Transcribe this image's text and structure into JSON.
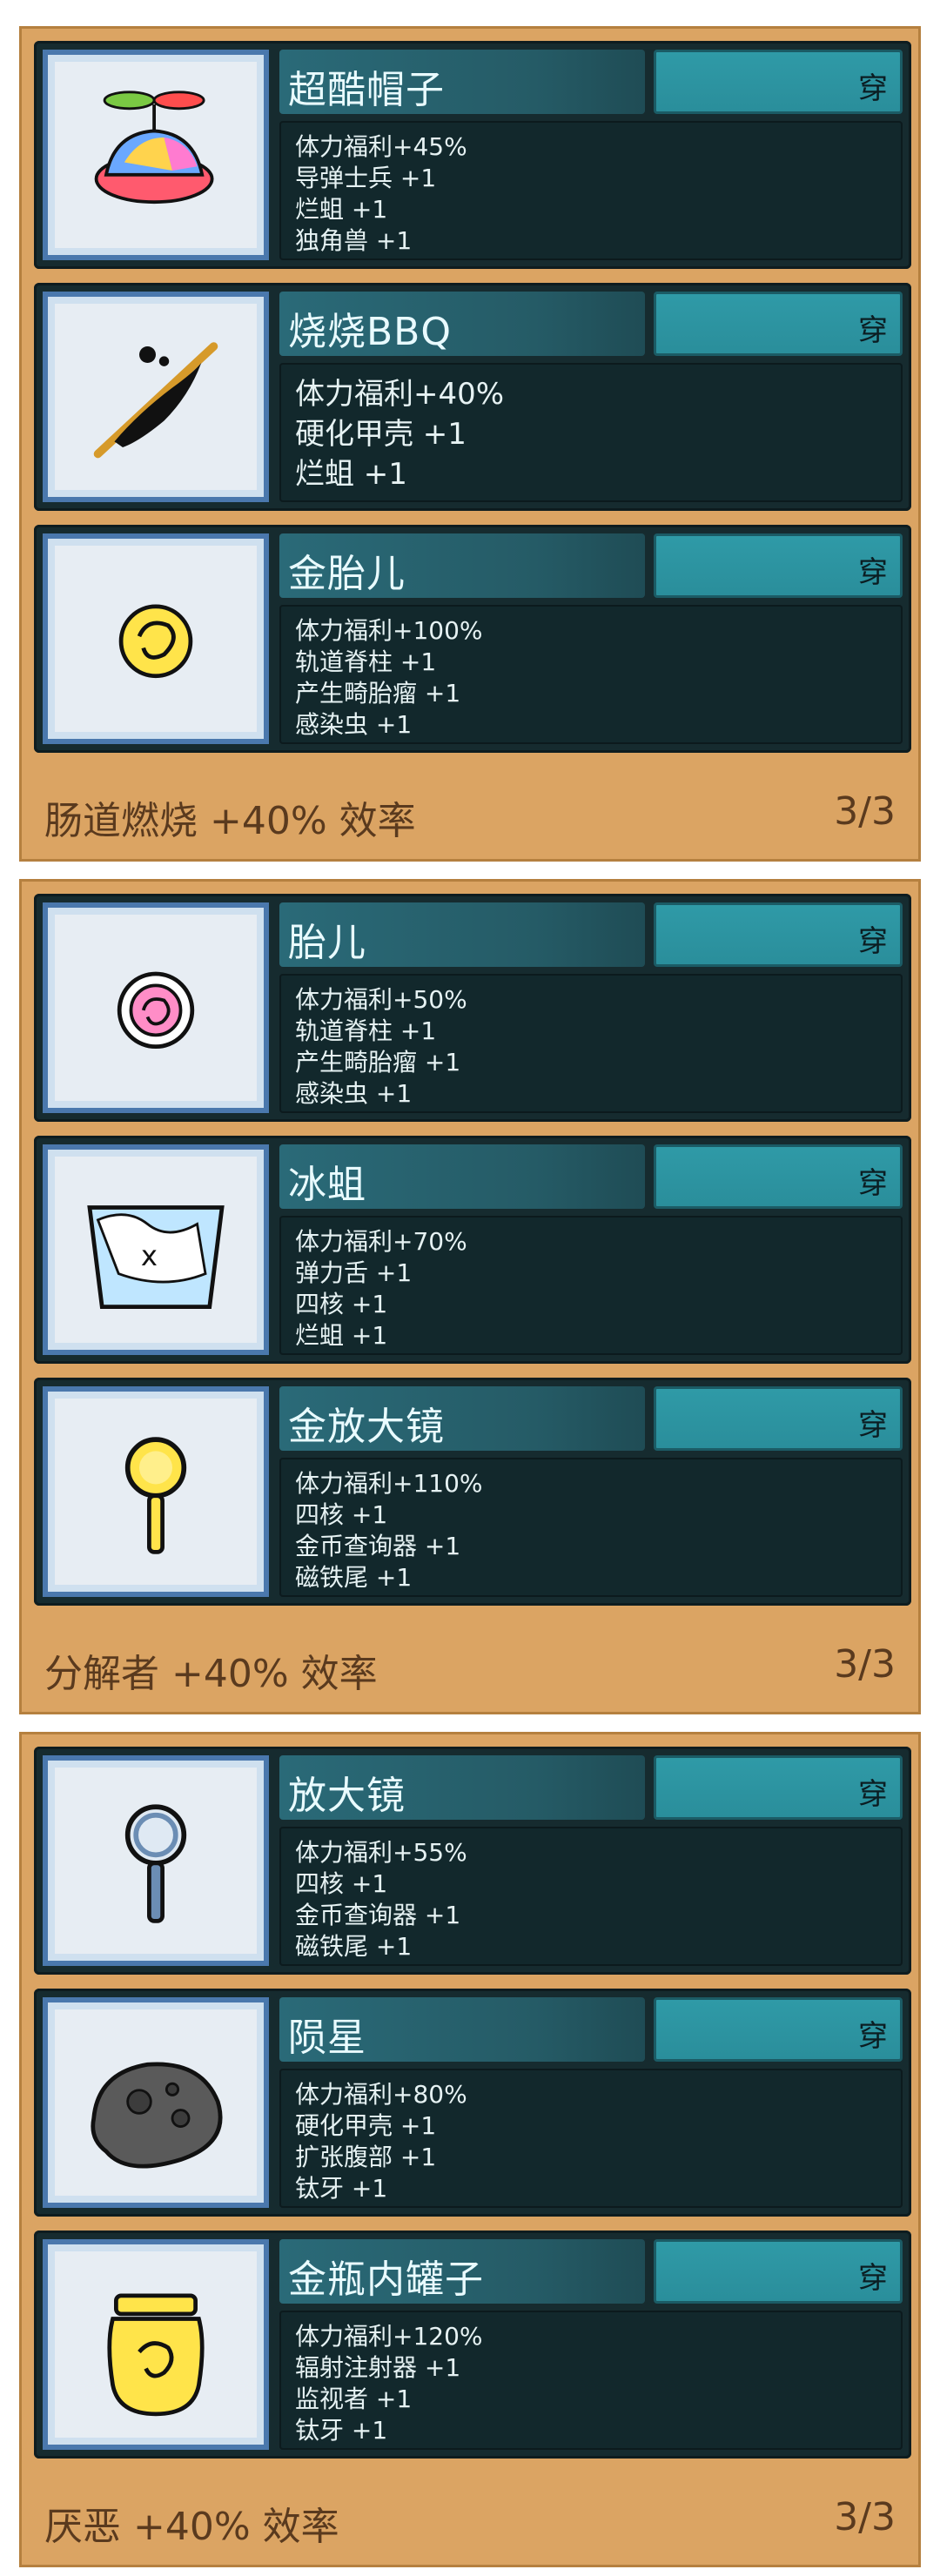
{
  "sets": [
    {
      "items": [
        {
          "name": "超酷帽子",
          "button": "穿",
          "stats": [
            "体力福利+45%",
            "导弹士兵 +1",
            "烂蛆 +1",
            "独角兽 +1"
          ],
          "icon": "propeller-hat-icon"
        },
        {
          "name": "烧烧BBQ",
          "button": "穿",
          "stats": [
            "体力福利+40%",
            "硬化甲壳 +1",
            "烂蛆 +1"
          ],
          "icon": "burnt-skewer-icon"
        },
        {
          "name": "金胎儿",
          "button": "穿",
          "stats": [
            "体力福利+100%",
            "轨道脊柱 +1",
            "产生畸胎瘤 +1",
            "感染虫 +1"
          ],
          "icon": "gold-fetus-icon"
        }
      ],
      "footer": {
        "bonus": "肠道燃烧 +40% 效率",
        "count": "3/3"
      }
    },
    {
      "items": [
        {
          "name": "胎儿",
          "button": "穿",
          "stats": [
            "体力福利+50%",
            "轨道脊柱 +1",
            "产生畸胎瘤 +1",
            "感染虫 +1"
          ],
          "icon": "fetus-icon"
        },
        {
          "name": "冰蛆",
          "button": "穿",
          "stats": [
            "体力福利+70%",
            "弹力舌 +1",
            "四核 +1",
            "烂蛆 +1"
          ],
          "icon": "ice-maggot-icon"
        },
        {
          "name": "金放大镜",
          "button": "穿",
          "stats": [
            "体力福利+110%",
            "四核 +1",
            "金币查询器 +1",
            "磁铁尾 +1"
          ],
          "icon": "gold-magnifier-icon"
        }
      ],
      "footer": {
        "bonus": "分解者 +40% 效率",
        "count": "3/3"
      }
    },
    {
      "items": [
        {
          "name": "放大镜",
          "button": "穿",
          "stats": [
            "体力福利+55%",
            "四核 +1",
            "金币查询器 +1",
            "磁铁尾 +1"
          ],
          "icon": "magnifier-icon"
        },
        {
          "name": "陨星",
          "button": "穿",
          "stats": [
            "体力福利+80%",
            "硬化甲壳 +1",
            "扩张腹部 +1",
            "钛牙 +1"
          ],
          "icon": "meteor-icon"
        },
        {
          "name": "金瓶内罐子",
          "button": "穿",
          "stats": [
            "体力福利+120%",
            "辐射注射器 +1",
            "监视者 +1",
            "钛牙 +1"
          ],
          "icon": "gold-jar-icon"
        }
      ],
      "footer": {
        "bonus": "厌恶 +40% 效率",
        "count": "3/3"
      }
    }
  ],
  "colors": {
    "panel": "#dba463",
    "card": "#162b2f",
    "button": "#2f9aa7",
    "thumb_border": "#4a78ad"
  }
}
